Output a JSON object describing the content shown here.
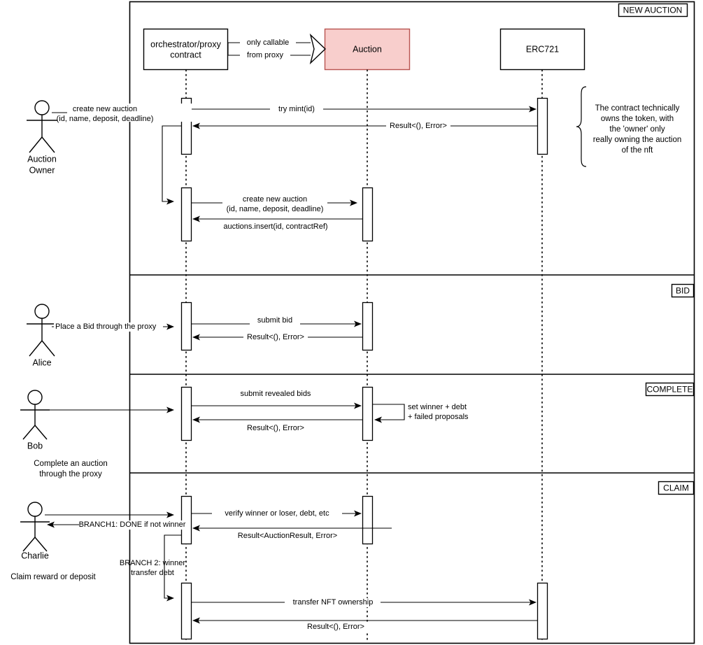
{
  "diagram": {
    "title": "Auction sequence diagram",
    "colors": {
      "accent_fill": "#f8cecc",
      "accent_stroke": "#b85450",
      "line": "#000000",
      "background": "#ffffff"
    }
  },
  "participants": [
    {
      "id": "proxy",
      "label_line1": "orchestrator/proxy",
      "label_line2": "contract",
      "style": "plain"
    },
    {
      "id": "auction",
      "label_line1": "Auction",
      "label_line2": "",
      "style": "accent"
    },
    {
      "id": "erc721",
      "label_line1": "ERC721",
      "label_line2": "",
      "style": "plain"
    }
  ],
  "connector_note": {
    "line1": "only callable",
    "line2": "from proxy"
  },
  "actors": [
    {
      "id": "owner",
      "name_line1": "Auction",
      "name_line2": "Owner"
    },
    {
      "id": "alice",
      "name_line1": "Alice",
      "name_line2": ""
    },
    {
      "id": "bob",
      "name_line1": "Bob",
      "name_line2": ""
    },
    {
      "id": "charlie",
      "name_line1": "Charlie",
      "name_line2": ""
    }
  ],
  "fragments": [
    {
      "id": "new-auction",
      "label": "NEW AUCTION"
    },
    {
      "id": "bid",
      "label": "BID"
    },
    {
      "id": "complete",
      "label": "COMPLETE"
    },
    {
      "id": "claim",
      "label": "CLAIM"
    }
  ],
  "notes": {
    "ownership": {
      "line1": "The contract technically",
      "line2": "owns the token, with",
      "line3": "the 'owner' only",
      "line4": "really owning the auction",
      "line5": "of the nft"
    },
    "bob_caption": {
      "line1": "Complete an auction",
      "line2": "through the proxy"
    },
    "charlie_caption": {
      "line1": "Claim reward or deposit"
    },
    "branch2": {
      "line1": "BRANCH 2: winner",
      "line2": "transfer debt"
    },
    "self_message": {
      "line1": "set  winner + debt",
      "line2": "+ failed proposals"
    }
  },
  "messages": {
    "create_auction_owner_l1": "create new auction",
    "create_auction_owner_l2": "(id, name, deposit, deadline)",
    "try_mint": "try mint(id)",
    "result_unit_error_1": "Result<(), Error>",
    "create_auction_l1": "create new auction",
    "create_auction_l2": "(id, name, deposit, deadline)",
    "auctions_insert": "auctions.insert(id, contractRef)",
    "place_bid_proxy": "Place a Bid through the proxy",
    "submit_bid": "submit bid",
    "result_unit_error_2": "Result<(), Error>",
    "submit_revealed_bids": "submit revealed bids",
    "result_unit_error_3": "Result<(), Error>",
    "verify_winner": "verify winner  or loser, debt, etc",
    "result_auction_result": "Result<AuctionResult, Error>",
    "branch1_done": "BRANCH1: DONE if not winner",
    "transfer_nft": "transfer NFT ownership",
    "result_unit_error_4": "Result<(), Error>"
  }
}
